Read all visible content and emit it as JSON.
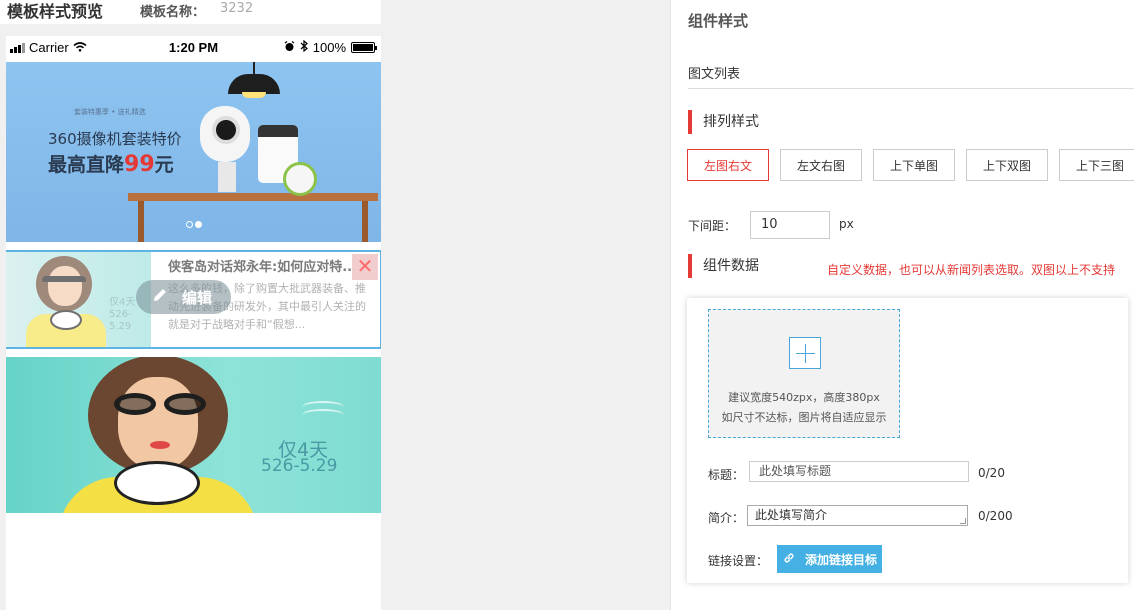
{
  "preview": {
    "title": "模板样式预览",
    "name_label": "模板名称：",
    "name_value": "3232"
  },
  "statusbar": {
    "carrier": "Carrier",
    "time": "1:20 PM",
    "battery": "100%"
  },
  "banner": {
    "small_text": "套装特惠季 • 送礼精选",
    "line1": "360摄像机套装特价",
    "line2_prefix": "最高直降",
    "line2_number": "99",
    "line2_suffix": "元",
    "active_slide": 2,
    "slide_count": 2
  },
  "news_item": {
    "title": "侠客岛对话郑永年:如何应对特...",
    "summary": "这么多的钱，除了购置大批武器装备、推动先进装备的研发外，其中最引人关注的就是对于战略对手和“假想...",
    "edit_label": "编辑",
    "close_symbol": "✕",
    "thumb_text_line1": "仅4天",
    "thumb_text_line2": "526-5.29"
  },
  "big_image": {
    "text1": "仅4天",
    "text2": "526-5.29"
  },
  "panel": {
    "section_title": "组件样式",
    "component_type": "图文列表",
    "layout_heading": "排列样式",
    "layout_options": [
      "左图右文",
      "左文右图",
      "上下单图",
      "上下双图",
      "上下三图"
    ],
    "active_layout": "左图右文",
    "spacing_label": "下间距：",
    "spacing_value": "10",
    "spacing_unit": "px",
    "data_heading": "组件数据",
    "data_note": "自定义数据，也可以从新闻列表选取。双图以上不支持",
    "upload_hint_1": "建议宽度540zpx，高度380px",
    "upload_hint_2": "如尺寸不达标，图片将自适应显示",
    "title_label": "标题：",
    "title_placeholder": "此处填写标题",
    "title_counter": "0/20",
    "summary_label": "简介：",
    "summary_value": "此处填写简介",
    "summary_counter": "0/200",
    "link_label": "链接设置：",
    "link_button": "添加链接目标"
  },
  "colors": {
    "accent_red": "#e53935",
    "accent_blue": "#45b0e3",
    "selected_border": "#5fb3e3"
  }
}
